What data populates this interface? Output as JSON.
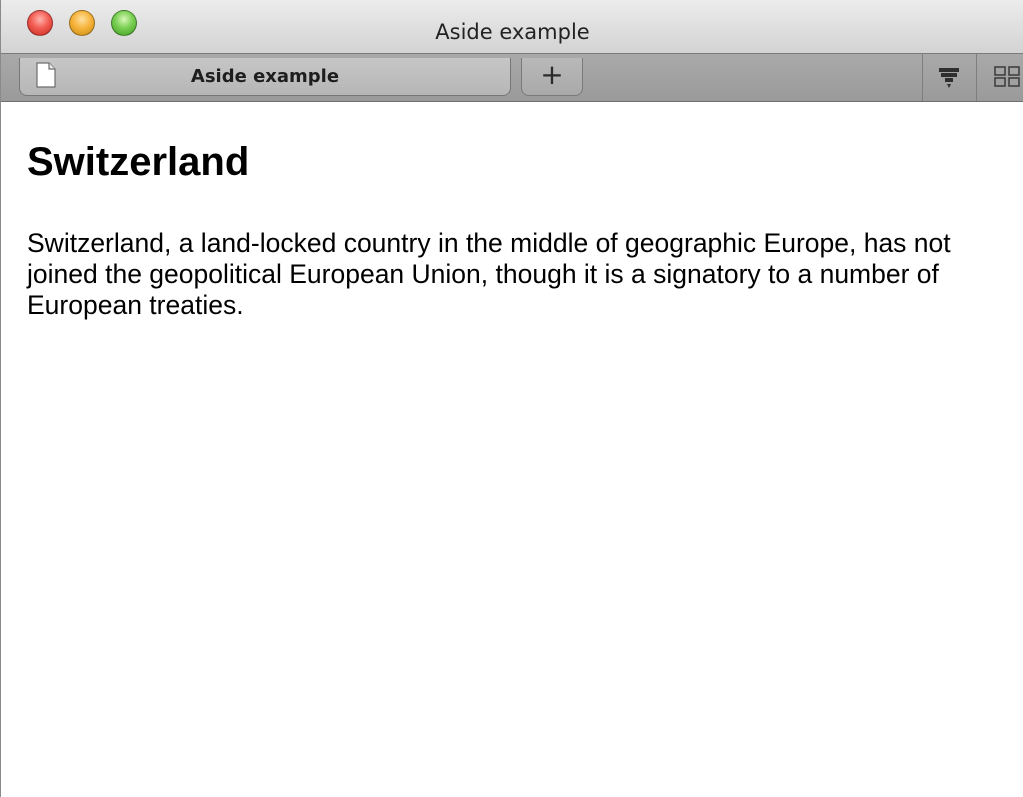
{
  "window": {
    "title": "Aside example"
  },
  "tabs": [
    {
      "label": "Aside example",
      "icon": "page-icon",
      "active": true
    }
  ],
  "tabbar": {
    "new_tab_label": "+",
    "right_icons": [
      "reading-list-icon",
      "top-sites-icon"
    ]
  },
  "page": {
    "heading": "Switzerland",
    "paragraph": "Switzerland, a land-locked country in the middle of geographic Europe, has not joined the geopolitical European Union, though it is a signatory to a number of European treaties."
  },
  "colors": {
    "close": "#f25d53",
    "minimize": "#f6b43c",
    "zoom": "#79cf52",
    "tabbar": "#a9a9a9",
    "text": "#000000"
  }
}
